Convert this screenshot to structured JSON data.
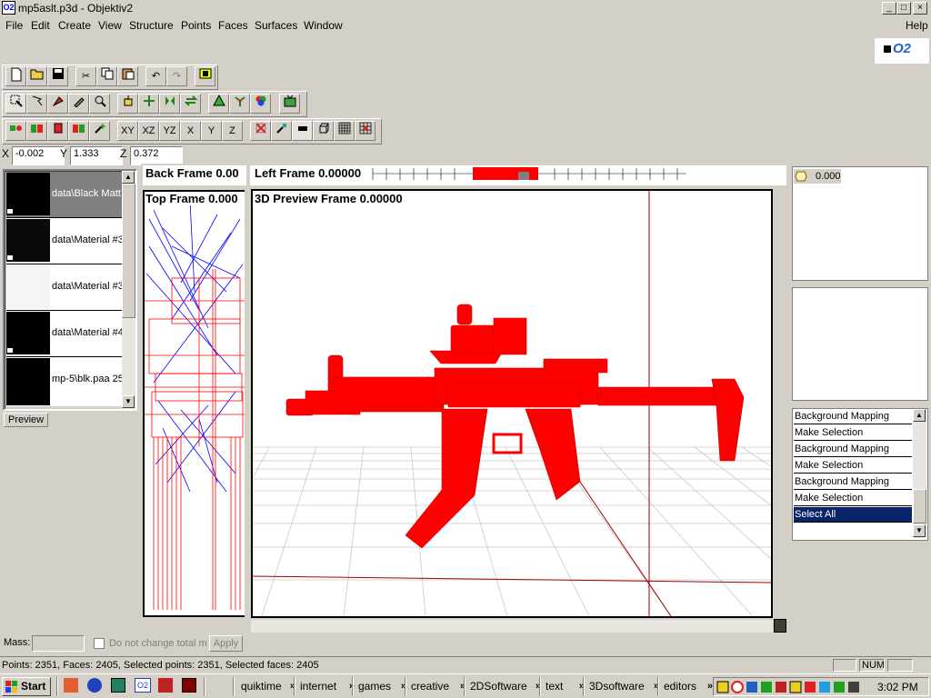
{
  "window": {
    "title": "mp5aslt.p3d - Objektiv2",
    "icon_text": "O2",
    "minimize": "_",
    "maximize": "□",
    "close": "×"
  },
  "menu": [
    "File",
    "Edit",
    "Create",
    "View",
    "Structure",
    "Points",
    "Faces",
    "Surfaces",
    "Window",
    "Help"
  ],
  "logo": "O2",
  "axis_buttons": [
    "XY",
    "XZ",
    "YZ",
    "X",
    "Y",
    "Z"
  ],
  "coords": {
    "x_label": "X",
    "x_value": "-0.002",
    "y_label": "Y",
    "y_value": "1.333",
    "z_label": "Z",
    "z_value": "0.372"
  },
  "materials": [
    {
      "label": "data\\Black Matt",
      "selected": true
    },
    {
      "label": "data\\Material #3"
    },
    {
      "label": "data\\Material #3"
    },
    {
      "label": "data\\Material #4"
    },
    {
      "label": "mp-5\\blk.paa 25"
    }
  ],
  "preview_tab": "Preview",
  "viewports": {
    "back": "Back Frame 0.00",
    "left": "Left Frame 0.00000",
    "top": "Top Frame 0.000",
    "preview": "3D Preview Frame 0.00000"
  },
  "lod_value": "0.000",
  "history": [
    "Background Mapping",
    "Make Selection",
    "Background Mapping",
    "Make Selection",
    "Background Mapping",
    "Make Selection",
    "Select All"
  ],
  "mass": {
    "label": "Mass:",
    "value": "",
    "checkbox_label": "Do not change total m",
    "apply": "Apply"
  },
  "status": {
    "text": "Points: 2351, Faces: 2405, Selected points: 2351, Selected faces: 2405",
    "num": "NUM"
  },
  "taskbar": {
    "start": "Start",
    "tasks": [
      "quiktime",
      "internet",
      "games",
      "creative",
      "2DSoftware",
      "text",
      "3Dsoftware",
      "editors"
    ],
    "chevron": "»",
    "clock": "3:02 PM"
  },
  "colors": {
    "face_bg": "#d4d0c8",
    "model": "#ff0000",
    "wire_blue": "#0000ff",
    "selection": "#0a246a"
  }
}
